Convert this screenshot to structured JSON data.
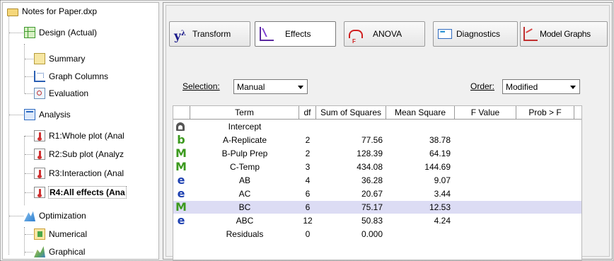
{
  "tree": {
    "root": "Notes for Paper.dxp",
    "design": "Design (Actual)",
    "summary": "Summary",
    "graph_columns": "Graph Columns",
    "evaluation": "Evaluation",
    "analysis": "Analysis",
    "r1": "R1:Whole plot (Anal",
    "r2": "R2:Sub plot (Analyz",
    "r3": "R3:Interaction (Anal",
    "r4": "R4:All effects (Ana",
    "optimization": "Optimization",
    "numerical": "Numerical",
    "graphical": "Graphical"
  },
  "tabs": {
    "transform_symbol": "y",
    "transform_sup": "λ",
    "transform": "Transform",
    "effects": "Effects",
    "anova": "ANOVA",
    "diagnostics": "Diagnostics",
    "model_graphs": "Model Graphs"
  },
  "controls": {
    "selection_label": "Selection:",
    "selection_value": "Manual",
    "order_label": "Order:",
    "order_value": "Modified"
  },
  "table": {
    "headers": {
      "term": "Term",
      "df": "df",
      "ss": "Sum of Squares",
      "ms": "Mean Square",
      "f": "F Value",
      "p": "Prob > F"
    },
    "rows": [
      {
        "sym": "lock",
        "term": "Intercept",
        "df": "",
        "ss": "",
        "ms": ""
      },
      {
        "sym": "b",
        "term": "A-Replicate",
        "df": "2",
        "ss": "77.56",
        "ms": "38.78"
      },
      {
        "sym": "M",
        "term": "B-Pulp Prep",
        "df": "2",
        "ss": "128.39",
        "ms": "64.19"
      },
      {
        "sym": "M",
        "term": "C-Temp",
        "df": "3",
        "ss": "434.08",
        "ms": "144.69"
      },
      {
        "sym": "e",
        "term": "AB",
        "df": "4",
        "ss": "36.28",
        "ms": "9.07"
      },
      {
        "sym": "e",
        "term": "AC",
        "df": "6",
        "ss": "20.67",
        "ms": "3.44"
      },
      {
        "sym": "M",
        "term": "BC",
        "df": "6",
        "ss": "75.17",
        "ms": "12.53"
      },
      {
        "sym": "e",
        "term": "ABC",
        "df": "12",
        "ss": "50.83",
        "ms": "4.24"
      },
      {
        "sym": "",
        "term": "Residuals",
        "df": "0",
        "ss": "0.000",
        "ms": ""
      }
    ],
    "highlighted_row": 6
  },
  "colors": {
    "sym_b": "#3c9a1e",
    "sym_M": "#3c9a1e",
    "sym_e": "#1c3fb0",
    "highlight": "#dcdcf4"
  }
}
